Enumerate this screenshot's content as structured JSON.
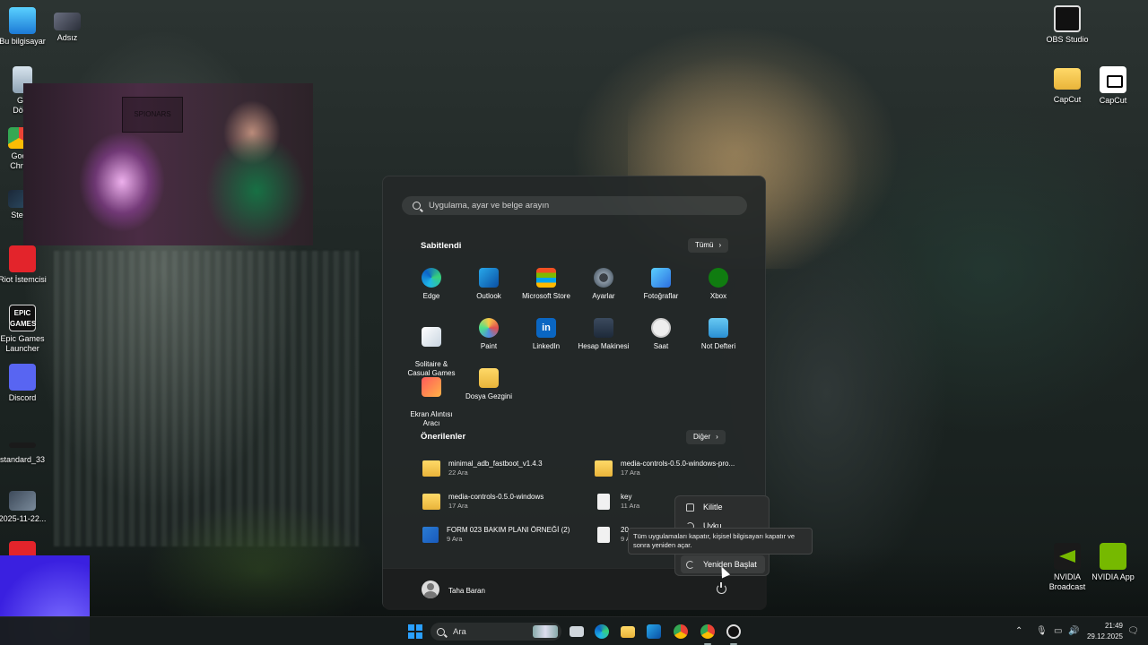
{
  "desktop": {
    "left_icons": [
      {
        "label": "Bu bilgisayar",
        "icon": "computer-icon"
      },
      {
        "label": "Adsız",
        "icon": "image-file-icon"
      },
      {
        "label": "Ge\nDönü",
        "icon": "recycle-bin-icon"
      },
      {
        "label": "Goo\nChro",
        "icon": "chrome-icon"
      },
      {
        "label": "Ste",
        "icon": "steam-icon"
      },
      {
        "label": "Riot İstemcisi",
        "icon": "riot-icon"
      },
      {
        "label": "Epic Games\nLauncher",
        "icon": "epic-games-icon"
      },
      {
        "label": "Discord",
        "icon": "discord-icon"
      },
      {
        "label": "standard_33",
        "icon": "file-icon"
      },
      {
        "label": "2025-11-22...",
        "icon": "video-thumbnail-icon"
      }
    ],
    "epic_badge": "EPIC\nGAMES",
    "right_icons": [
      {
        "label": "OBS Studio",
        "icon": "obs-icon"
      },
      {
        "label": "CapCut",
        "icon": "folder-icon"
      },
      {
        "label": "CapCut",
        "icon": "capcut-icon"
      },
      {
        "label": "NVIDIA\nBroadcast",
        "icon": "nvidia-broadcast-icon"
      },
      {
        "label": "NVIDIA App",
        "icon": "nvidia-app-icon"
      }
    ]
  },
  "webcam": {
    "logo_text": "SPIONARS"
  },
  "start_menu": {
    "search_placeholder": "Uygulama, ayar ve belge arayın",
    "pinned": {
      "title": "Sabitlendi",
      "all_button": "Tümü",
      "apps": [
        {
          "label": "Edge",
          "icon": "edge-icon"
        },
        {
          "label": "Outlook",
          "icon": "outlook-icon"
        },
        {
          "label": "Microsoft Store",
          "icon": "store-icon"
        },
        {
          "label": "Ayarlar",
          "icon": "settings-icon"
        },
        {
          "label": "Fotoğraflar",
          "icon": "photos-icon"
        },
        {
          "label": "Xbox",
          "icon": "xbox-icon"
        },
        {
          "label": "Solitaire &\nCasual Games",
          "icon": "solitaire-icon"
        },
        {
          "label": "Paint",
          "icon": "paint-icon"
        },
        {
          "label": "LinkedIn",
          "icon": "linkedin-icon"
        },
        {
          "label": "Hesap Makinesi",
          "icon": "calculator-icon"
        },
        {
          "label": "Saat",
          "icon": "clock-icon"
        },
        {
          "label": "Not Defteri",
          "icon": "notepad-icon"
        },
        {
          "label": "Ekran Alıntısı\nAracı",
          "icon": "snipping-tool-icon"
        },
        {
          "label": "Dosya Gezgini",
          "icon": "file-explorer-icon"
        }
      ],
      "linkedin_glyph": "in"
    },
    "recommended": {
      "title": "Önerilenler",
      "more_button": "Diğer",
      "items": [
        {
          "name": "minimal_adb_fastboot_v1.4.3",
          "date": "22 Ara",
          "type": "folder"
        },
        {
          "name": "media-controls-0.5.0-windows-pro...",
          "date": "17 Ara",
          "type": "folder"
        },
        {
          "name": "media-controls-0.5.0-windows",
          "date": "17 Ara",
          "type": "folder"
        },
        {
          "name": "key",
          "date": "11 Ara",
          "type": "file"
        },
        {
          "name": "FORM 023 BAKIM PLANI ÖRNEĞİ (2)",
          "date": "9 Ara",
          "type": "word"
        },
        {
          "name": "20",
          "date": "9 A",
          "type": "file"
        }
      ]
    },
    "user_name": "Taha Baran",
    "power_menu": {
      "lock": "Kilitle",
      "sleep": "Uyku",
      "restart": "Yeniden Başlat"
    },
    "tooltip": "Tüm uygulamaları kapatır, kişisel bilgisayarı kapatır ve sonra yeniden açar."
  },
  "taskbar": {
    "search_text": "Ara",
    "time": "21:49",
    "date": "29.12.2025"
  }
}
